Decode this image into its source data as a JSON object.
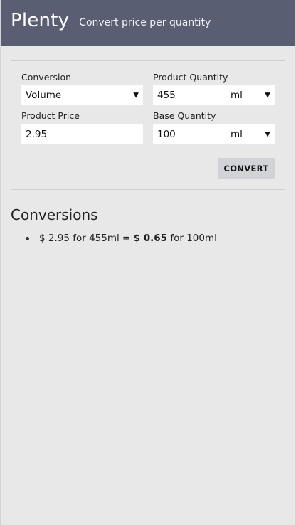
{
  "header": {
    "title": "Plenty",
    "subtitle": "Convert price per quantity"
  },
  "form": {
    "conversion": {
      "label": "Conversion",
      "value": "Volume"
    },
    "product_quantity": {
      "label": "Product Quantity",
      "value": "455",
      "unit": "ml"
    },
    "product_price": {
      "label": "Product Price",
      "value": "2.95"
    },
    "base_quantity": {
      "label": "Base Quantity",
      "value": "100",
      "unit": "ml"
    },
    "convert_label": "CONVERT"
  },
  "conversions": {
    "title": "Conversions",
    "items": [
      {
        "prefix": "$ 2.95 for 455ml =",
        "result": "$ 0.65",
        "suffix": "for 100ml"
      }
    ]
  },
  "icons": {
    "dropdown": "caret-down-icon",
    "bullet": "bullet-icon"
  },
  "colors": {
    "header_bg": "#5a5e72",
    "page_bg": "#e8e8e8",
    "button_bg": "#d2d3d7"
  }
}
